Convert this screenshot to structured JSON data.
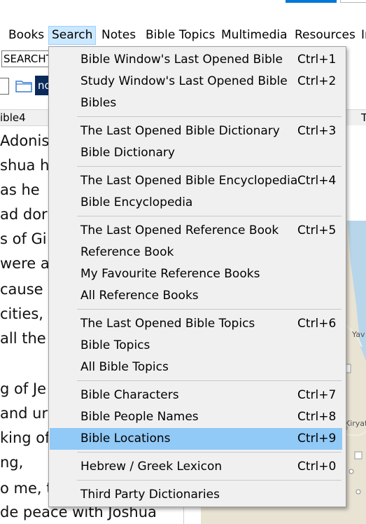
{
  "menubar": {
    "items": [
      {
        "label": "Books"
      },
      {
        "label": "Search"
      },
      {
        "label": "Notes"
      },
      {
        "label": "Bible Topics"
      },
      {
        "label": "Multimedia"
      },
      {
        "label": "Resources"
      },
      {
        "label": "In"
      }
    ]
  },
  "toolbar": {
    "search_value": "SEARCHT",
    "nav_label": "no"
  },
  "tabs": {
    "left_label": "ible4",
    "right_label": "T"
  },
  "bible_text": [
    "Adonis",
    "shua h",
    "as he",
    "ad dor",
    "s of Gi",
    "were a",
    "cause",
    " cities,",
    "all the",
    "g of Je",
    "and ur",
    "king of",
    "ng,",
    "o me, t",
    "de peace with Joshua"
  ],
  "map_labels": [
    "Yav",
    "Kiryat"
  ],
  "search_menu": {
    "groups": [
      [
        {
          "label": "Bible Window's Last Opened Bible",
          "shortcut": "Ctrl+1"
        },
        {
          "label": "Study Window's Last Opened Bible",
          "shortcut": "Ctrl+2"
        },
        {
          "label": "Bibles",
          "shortcut": ""
        }
      ],
      [
        {
          "label": "The Last Opened Bible Dictionary",
          "shortcut": "Ctrl+3"
        },
        {
          "label": "Bible Dictionary",
          "shortcut": ""
        }
      ],
      [
        {
          "label": "The Last Opened Bible Encyclopedia",
          "shortcut": "Ctrl+4"
        },
        {
          "label": "Bible Encyclopedia",
          "shortcut": ""
        }
      ],
      [
        {
          "label": "The Last Opened Reference Book",
          "shortcut": "Ctrl+5"
        },
        {
          "label": "Reference Book",
          "shortcut": ""
        },
        {
          "label": "My Favourite Reference Books",
          "shortcut": ""
        },
        {
          "label": "All Reference Books",
          "shortcut": ""
        }
      ],
      [
        {
          "label": "The Last Opened Bible Topics",
          "shortcut": "Ctrl+6"
        },
        {
          "label": "Bible Topics",
          "shortcut": ""
        },
        {
          "label": "All Bible Topics",
          "shortcut": ""
        }
      ],
      [
        {
          "label": "Bible Characters",
          "shortcut": "Ctrl+7"
        },
        {
          "label": "Bible People Names",
          "shortcut": "Ctrl+8"
        },
        {
          "label": "Bible Locations",
          "shortcut": "Ctrl+9",
          "highlighted": true
        }
      ],
      [
        {
          "label": "Hebrew / Greek Lexicon",
          "shortcut": "Ctrl+0"
        }
      ],
      [
        {
          "label": "Third Party Dictionaries",
          "shortcut": ""
        }
      ]
    ]
  },
  "colors": {
    "highlight": "#91c9f7",
    "menu_bg": "#f0f0f0",
    "active_menu": "#cce8ff"
  }
}
